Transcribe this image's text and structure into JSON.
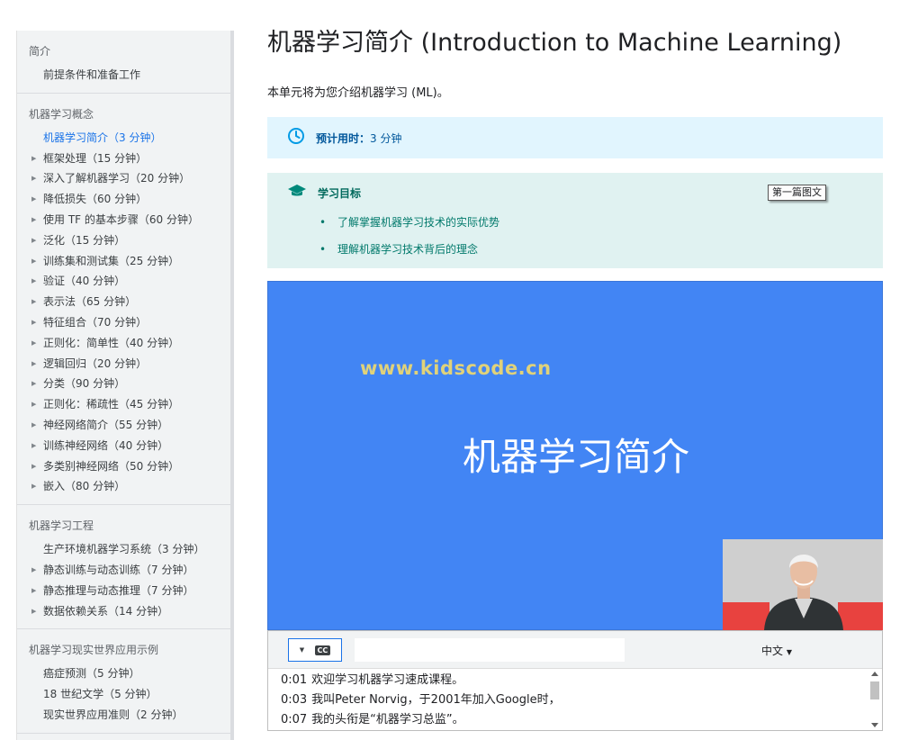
{
  "sidebar": {
    "sections": [
      {
        "title": "简介",
        "items": [
          {
            "label": "前提条件和准备工作",
            "expandable": false,
            "active": false
          }
        ]
      },
      {
        "title": "机器学习概念",
        "items": [
          {
            "label": "机器学习简介（3 分钟）",
            "expandable": false,
            "active": true
          },
          {
            "label": "框架处理（15 分钟）",
            "expandable": true,
            "active": false
          },
          {
            "label": "深入了解机器学习（20 分钟）",
            "expandable": true,
            "active": false
          },
          {
            "label": "降低损失（60 分钟）",
            "expandable": true,
            "active": false
          },
          {
            "label": "使用 TF 的基本步骤（60 分钟）",
            "expandable": true,
            "active": false
          },
          {
            "label": "泛化（15 分钟）",
            "expandable": true,
            "active": false
          },
          {
            "label": "训练集和测试集（25 分钟）",
            "expandable": true,
            "active": false
          },
          {
            "label": "验证（40 分钟）",
            "expandable": true,
            "active": false
          },
          {
            "label": "表示法（65 分钟）",
            "expandable": true,
            "active": false
          },
          {
            "label": "特征组合（70 分钟）",
            "expandable": true,
            "active": false
          },
          {
            "label": "正则化：简单性（40 分钟）",
            "expandable": true,
            "active": false
          },
          {
            "label": "逻辑回归（20 分钟）",
            "expandable": true,
            "active": false
          },
          {
            "label": "分类（90 分钟）",
            "expandable": true,
            "active": false
          },
          {
            "label": "正则化：稀疏性（45 分钟）",
            "expandable": true,
            "active": false
          },
          {
            "label": "神经网络简介（55 分钟）",
            "expandable": true,
            "active": false
          },
          {
            "label": "训练神经网络（40 分钟）",
            "expandable": true,
            "active": false
          },
          {
            "label": "多类别神经网络（50 分钟）",
            "expandable": true,
            "active": false
          },
          {
            "label": "嵌入（80 分钟）",
            "expandable": true,
            "active": false
          }
        ]
      },
      {
        "title": "机器学习工程",
        "items": [
          {
            "label": "生产环境机器学习系统（3 分钟）",
            "expandable": false,
            "active": false
          },
          {
            "label": "静态训练与动态训练（7 分钟）",
            "expandable": true,
            "active": false
          },
          {
            "label": "静态推理与动态推理（7 分钟）",
            "expandable": true,
            "active": false
          },
          {
            "label": "数据依赖关系（14 分钟）",
            "expandable": true,
            "active": false
          }
        ]
      },
      {
        "title": "机器学习现实世界应用示例",
        "items": [
          {
            "label": "癌症预测（5 分钟）",
            "expandable": false,
            "active": false
          },
          {
            "label": "18 世纪文学（5 分钟）",
            "expandable": false,
            "active": false
          },
          {
            "label": "现实世界应用准则（2 分钟）",
            "expandable": false,
            "active": false
          }
        ]
      }
    ]
  },
  "main": {
    "title": "机器学习简介 (Introduction to Machine Learning)",
    "intro": "本单元将为您介绍机器学习 (ML)。",
    "time_box": {
      "label": "预计用时：",
      "value": "3 分钟",
      "icon": "clock-icon"
    },
    "goals": {
      "title": "学习目标",
      "icon": "graduation-cap-icon",
      "items": [
        "了解掌握机器学习技术的实际优势",
        "理解机器学习技术背后的理念"
      ],
      "tooltip": "第一篇图文"
    },
    "video": {
      "watermark": "www.kidscode.cn",
      "slide_title": "机器学习简介"
    },
    "transcript": {
      "language": "中文",
      "search_placeholder": "",
      "lines": [
        {
          "time": "0:01",
          "text": "欢迎学习机器学习速成课程。"
        },
        {
          "time": "0:03",
          "text": "我叫Peter Norvig，于2001年加入Google时，"
        },
        {
          "time": "0:07",
          "text": "我的头衔是“机器学习总监”。"
        }
      ]
    }
  },
  "colors": {
    "accent": "#1a73e8",
    "time_box_bg": "#e1f5fe",
    "goal_box_bg": "#e0f2f1",
    "video_bg": "#4285f4"
  }
}
